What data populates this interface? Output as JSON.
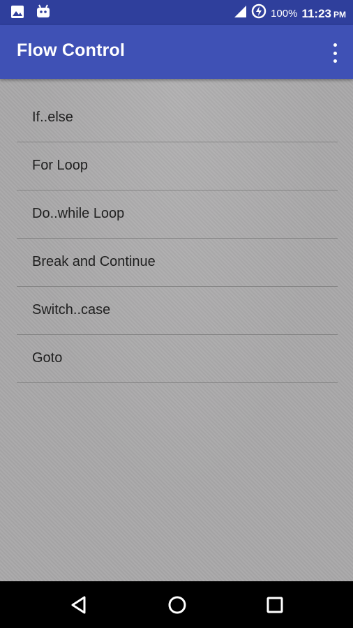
{
  "status_bar": {
    "icons_left": [
      "image-icon",
      "android-debug-icon"
    ],
    "battery": "100%",
    "time": "11:23",
    "ampm": "PM",
    "icons_right": [
      "signal-icon",
      "battery-charging-icon"
    ]
  },
  "app_bar": {
    "title": "Flow Control",
    "overflow_icon": "more-vert-icon"
  },
  "list": {
    "items": [
      {
        "label": "If..else"
      },
      {
        "label": "For Loop"
      },
      {
        "label": "Do..while Loop"
      },
      {
        "label": "Break and Continue"
      },
      {
        "label": "Switch..case"
      },
      {
        "label": "Goto"
      }
    ]
  },
  "nav_bar": {
    "buttons": [
      "back-icon",
      "home-icon",
      "recents-icon"
    ]
  },
  "colors": {
    "status_bar": "#2f3f9c",
    "app_bar": "#3f51b5",
    "background": "#a9a8a9",
    "nav_bar": "#000000"
  }
}
